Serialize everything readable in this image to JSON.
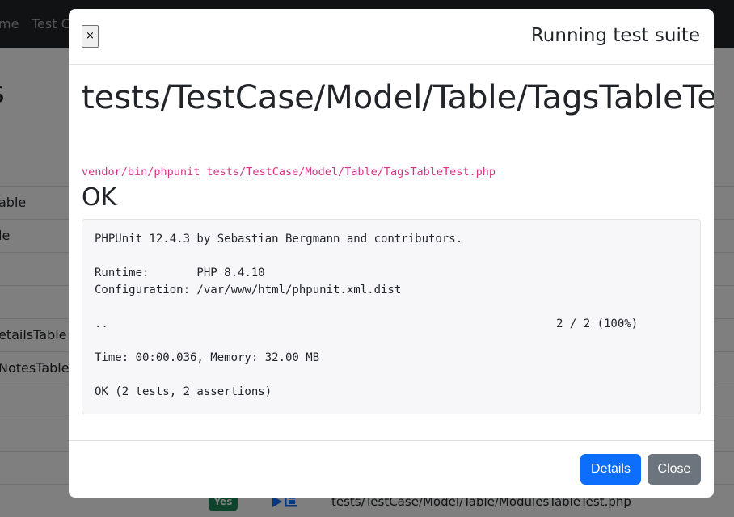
{
  "background": {
    "nav": {
      "items": [
        "me",
        "Test C"
      ]
    },
    "heading": "s",
    "rows": [
      {
        "label": "able"
      },
      {
        "label": "le"
      },
      {
        "label": ""
      },
      {
        "label": ""
      },
      {
        "label": "etailsTable"
      },
      {
        "label": "NotesTable"
      },
      {
        "label": ""
      },
      {
        "label": ""
      },
      {
        "label": ""
      }
    ],
    "last_row": {
      "badge": "Yes",
      "file": "tests/TestCase/Model/Table/ModulesTableTest.php"
    }
  },
  "modal": {
    "close_glyph": "×",
    "title": "Running test suite",
    "file_heading": "tests/TestCase/Model/Table/TagsTableTest.php",
    "command": "vendor/bin/phpunit tests/TestCase/Model/Table/TagsTableTest.php",
    "status": "OK",
    "output": {
      "header": "PHPUnit 12.4.3 by Sebastian Bergmann and contributors.",
      "runtime": "Runtime:       PHP 8.4.10",
      "configuration": "Configuration: /var/www/html/phpunit.xml.dist",
      "progress_dots": "..",
      "progress_count": "2 / 2 (100%)",
      "time_memory": "Time: 00:00.036, Memory: 32.00 MB",
      "result": "OK (2 tests, 2 assertions)"
    },
    "buttons": {
      "details": "Details",
      "close": "Close"
    }
  },
  "colors": {
    "primary": "#0d6efd",
    "secondary": "#6c757d",
    "success": "#198754",
    "code_pink": "#d63384"
  },
  "icons": {
    "run": "play-list-icon"
  }
}
